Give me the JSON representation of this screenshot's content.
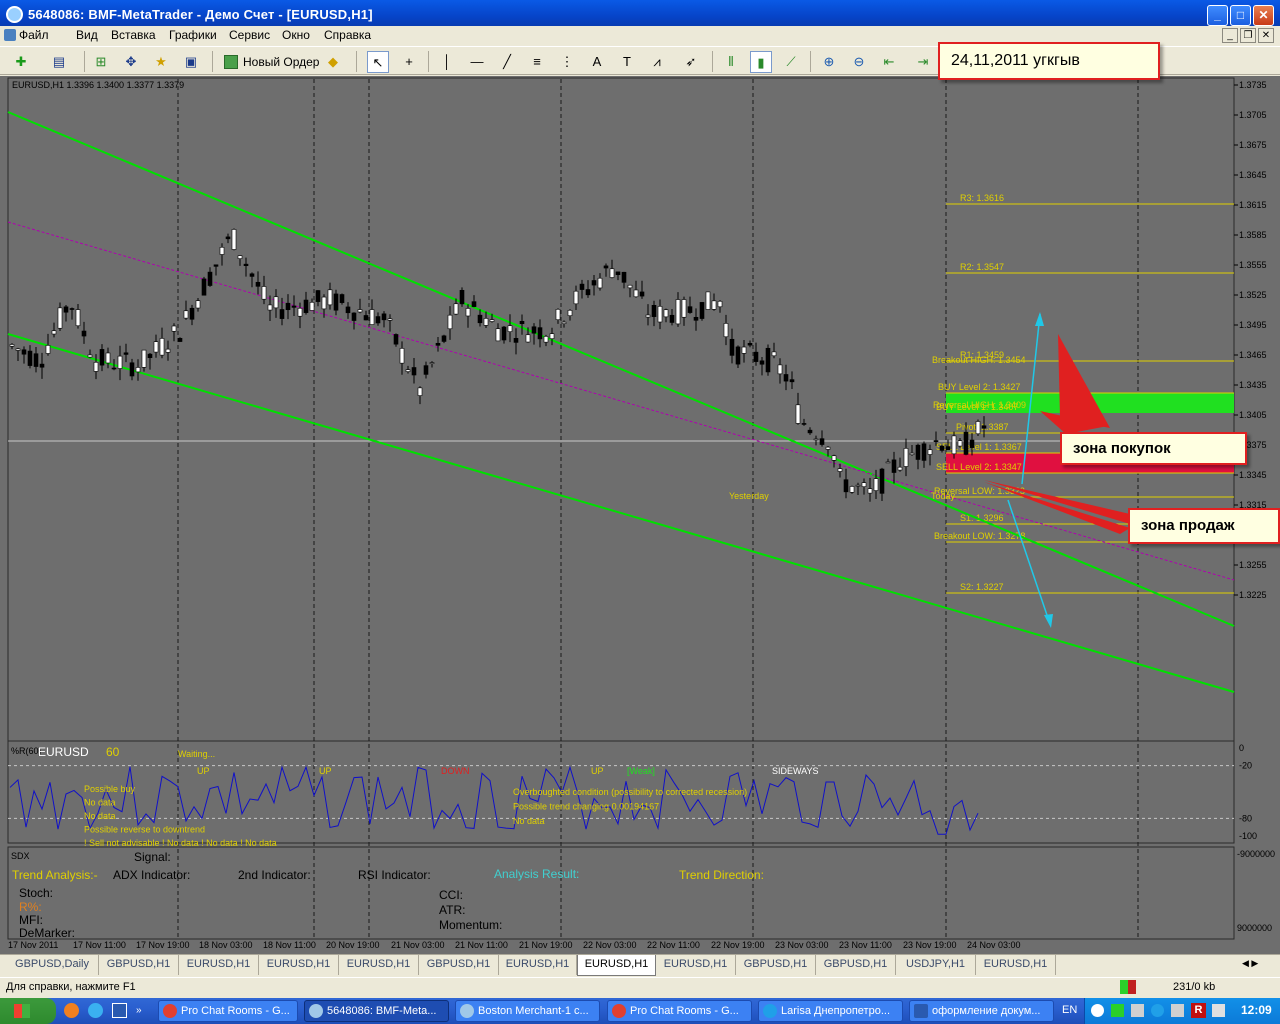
{
  "window": {
    "title": "5648086: BMF-MetaTrader - Демо Счет - [EURUSD,H1]",
    "min": "_",
    "max": "□",
    "close": "✕"
  },
  "menu": {
    "items": [
      "Файл",
      "Вид",
      "Вставка",
      "Графики",
      "Сервис",
      "Окно",
      "Справка"
    ]
  },
  "toolbar": {
    "new_order": "Новый Ордер"
  },
  "chart": {
    "info": "EURUSD,H1  1.3396 1.3400 1.3377 1.3379",
    "price_ticks": [
      "1.3735",
      "1.3705",
      "1.3675",
      "1.3645",
      "1.3615",
      "1.3585",
      "1.3555",
      "1.3525",
      "1.3495",
      "1.3465",
      "1.3435",
      "1.3405",
      "1.3375",
      "1.3345",
      "1.3315",
      "1.3285",
      "1.3255",
      "1.3225"
    ],
    "current_price": "1.3379",
    "levels": [
      {
        "label": "R3: 1.3616"
      },
      {
        "label": "R2: 1.3547"
      },
      {
        "label": "R1: 1.3459"
      },
      {
        "label": "Breakout HIGH: 1.3454"
      },
      {
        "label": "BUY Level 2: 1.3427"
      },
      {
        "label": "Reversal HIGH: 1.3409"
      },
      {
        "label": "BUY Level 1: 1.3407"
      },
      {
        "label": "Pivot: 1.3387"
      },
      {
        "label": "SELL Level 1: 1.3367"
      },
      {
        "label": "SELL Level 2: 1.3347"
      },
      {
        "label": "Reversal LOW: 1.3323"
      },
      {
        "label": "S1: 1.3296"
      },
      {
        "label": "Breakout LOW: 1.3278"
      },
      {
        "label": "S2: 1.3227"
      }
    ],
    "yesterday": "Yesterday",
    "today": "Today",
    "colors": {
      "channel": "#00e000",
      "midline": "#b000b0",
      "levels": "#e0d000",
      "buy_zone": "#20e020",
      "sell_zone": "#e01040",
      "price": "#c8c8c8"
    }
  },
  "callouts": {
    "date": "24,11,2011 угкгыв",
    "buy": "зона покупок",
    "sell": "зона продаж"
  },
  "indicator": {
    "name": "%R(60)",
    "symbol": "EURUSD",
    "period": "60",
    "waiting": "Waiting...",
    "ticks": [
      "0",
      "-20",
      "-80",
      "-100"
    ],
    "labels": [
      "UP",
      "UP",
      "DOWN",
      "UP",
      "[Weak]",
      "SIDEWAYS"
    ],
    "msg_left": [
      "Possible buy",
      "No data",
      "No data",
      "Possible reverse to downtrend",
      "! Sell not advisable  ! No data        ! No data        ! No data"
    ],
    "msg_mid": [
      "Overboughted condition (possibility to corrected recession)",
      "Possible trend changing 0.00194167",
      "No data"
    ]
  },
  "sdx": {
    "name": "SDX",
    "signal": "Signal:",
    "trend_analysis": "Trend Analysis:-",
    "adx": "ADX Indicator:",
    "second": "2nd Indicator:",
    "rsi": "RSI Indicator:",
    "analysis_result": "Analysis Result:",
    "trend_direction": "Trend Direction:",
    "stoch": "Stoch:",
    "r_pct": "R%:",
    "mfi": "MFI:",
    "demarker": "DeMarker:",
    "cci": "CCI:",
    "atr": "ATR:",
    "momentum": "Momentum:",
    "ticks": [
      "-9000000",
      "9000000"
    ]
  },
  "time_axis": [
    "17 Nov 2011",
    "17 Nov 11:00",
    "17 Nov 19:00",
    "18 Nov 03:00",
    "18 Nov 11:00",
    "20 Nov 19:00",
    "21 Nov 03:00",
    "21 Nov 11:00",
    "21 Nov 19:00",
    "22 Nov 03:00",
    "22 Nov 11:00",
    "22 Nov 19:00",
    "23 Nov 03:00",
    "23 Nov 11:00",
    "23 Nov 19:00",
    "24 Nov 03:00"
  ],
  "tabs": [
    "GBPUSD,Daily",
    "GBPUSD,H1",
    "EURUSD,H1",
    "EURUSD,H1",
    "EURUSD,H1",
    "GBPUSD,H1",
    "EURUSD,H1",
    "EURUSD,H1",
    "EURUSD,H1",
    "GBPUSD,H1",
    "GBPUSD,H1",
    "USDJPY,H1",
    "EURUSD,H1"
  ],
  "status": {
    "help": "Для справки, нажмите F1",
    "traffic": "231/0 kb"
  },
  "taskbar": {
    "items": [
      "Pro Chat Rooms - G...",
      "5648086: BMF-Meta...",
      "Boston Merchant-1 c...",
      "Pro Chat Rooms - G...",
      "Larisa Днепропетро...",
      "оформление докум..."
    ],
    "lang": "EN",
    "clock": "12:09"
  }
}
